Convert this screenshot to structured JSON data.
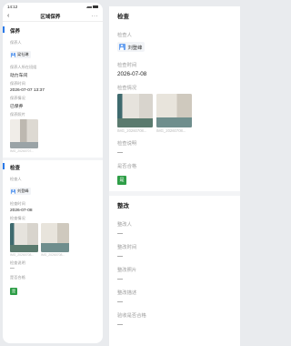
{
  "phone": {
    "status": {
      "time": "14:12"
    },
    "nav": {
      "back_icon": "back-arrow-icon",
      "title": "区域保养",
      "more": "···"
    },
    "maintenance": {
      "section_title": "保养",
      "fields": [
        {
          "label": "保养人",
          "person": "梁社琳"
        },
        {
          "label": "保养人所在班组",
          "value": "动力车间"
        },
        {
          "label": "保养时间",
          "value": "2026-07-07 13:37"
        },
        {
          "label": "保养情况",
          "value": "已保养"
        },
        {
          "label": "保养照片"
        }
      ],
      "photo_name": "IMG_20260707..."
    },
    "inspection": {
      "section_title": "检查",
      "checker_label": "检查人",
      "checker": "刘登峰",
      "time_label": "检查时间",
      "time": "2026-07-08",
      "situation_label": "检查情况",
      "photos": [
        "IMG_20260708...",
        "IMG_20260708..."
      ],
      "desc_label": "检查说明",
      "desc": "—",
      "pass_label": "是否合格",
      "pass": "是"
    }
  },
  "panel": {
    "inspection": {
      "section_title": "检查",
      "checker_label": "检查人",
      "checker": "刘登峰",
      "time_label": "检查时间",
      "time": "2026-07-08",
      "situation_label": "检查情况",
      "photos": [
        "IMG_20260708...",
        "IMG_20260708..."
      ],
      "desc_label": "检查说明",
      "desc": "—",
      "pass_label": "是否合格",
      "pass": "是"
    },
    "rectify": {
      "section_title": "整改",
      "fields": [
        {
          "label": "整改人",
          "value": "—"
        },
        {
          "label": "整改时间",
          "value": "—"
        },
        {
          "label": "整改照片",
          "value": "—"
        },
        {
          "label": "整改描述",
          "value": "—"
        },
        {
          "label": "验收是否合格",
          "value": "—"
        }
      ]
    }
  },
  "colors": {
    "accent": "#2a79e8",
    "pass": "#2e9e47",
    "avatar": "#6aa2f0",
    "background": "#e9ebee"
  }
}
